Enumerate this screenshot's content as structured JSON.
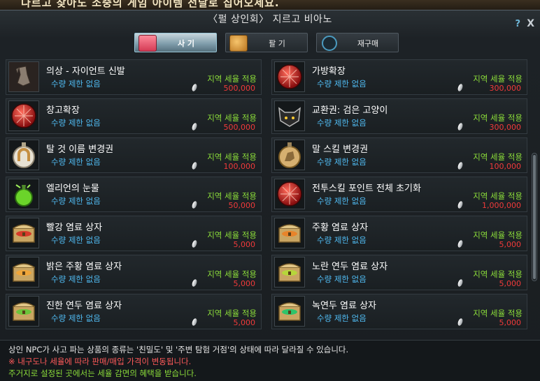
{
  "top_strip_text": "다르고 찾아도 소중의 게임 아이템 전달로 집어오세요.",
  "title": "〈펄 상인회〉 지르고 비아노",
  "help_label": "?",
  "close_label": "X",
  "tabs": [
    {
      "label": "사 기",
      "icon": "shopping-bag-icon",
      "active": true
    },
    {
      "label": "팔 기",
      "icon": "coin-stack-icon",
      "active": false
    },
    {
      "label": "재구매",
      "icon": "repurchase-ring-icon",
      "active": false
    }
  ],
  "tax_label": "지역 세율 적용",
  "items": [
    {
      "name": "의상 - 자이언트 신발",
      "limit": "수량 제한 없음",
      "price": "500,000",
      "icon": "giant-shoes-icon"
    },
    {
      "name": "가방확장",
      "limit": "수량 제한 없음",
      "price": "300,000",
      "icon": "red-orb-icon"
    },
    {
      "name": "창고확장",
      "limit": "수량 제한 없음",
      "price": "500,000",
      "icon": "red-orb-icon"
    },
    {
      "name": "교환권: 검은 고양이",
      "limit": "수량 제한 없음",
      "price": "300,000",
      "icon": "black-cat-icon"
    },
    {
      "name": "탈 것 이름 변경권",
      "limit": "수량 제한 없음",
      "price": "100,000",
      "icon": "horseshoe-medal-icon"
    },
    {
      "name": "말 스킬 변경권",
      "limit": "수량 제한 없음",
      "price": "100,000",
      "icon": "horse-skill-medal-icon"
    },
    {
      "name": "엘리언의 눈물",
      "limit": "수량 제한 없음",
      "price": "50,000",
      "icon": "green-potion-icon"
    },
    {
      "name": "전투스킬 포인트 전체 초기화",
      "limit": "수량 제한 없음",
      "price": "1,000,000",
      "icon": "red-orb-icon"
    },
    {
      "name": "빨강 염료 상자",
      "limit": "수량 제한 없음",
      "price": "5,000",
      "icon": "dye-chest-icon",
      "dye": "#d63a2a"
    },
    {
      "name": "주황 염료 상자",
      "limit": "수량 제한 없음",
      "price": "5,000",
      "icon": "dye-chest-icon",
      "dye": "#e8842a"
    },
    {
      "name": "밝은 주황 염료 상자",
      "limit": "수량 제한 없음",
      "price": "5,000",
      "icon": "dye-chest-icon",
      "dye": "#f0a63a"
    },
    {
      "name": "노란 연두 염료 상자",
      "limit": "수량 제한 없음",
      "price": "5,000",
      "icon": "dye-chest-icon",
      "dye": "#b6d63a"
    },
    {
      "name": "진한 연두 염료 상자",
      "limit": "수량 제한 없음",
      "price": "5,000",
      "icon": "dye-chest-icon",
      "dye": "#6cc43a"
    },
    {
      "name": "녹연두 염료 상자",
      "limit": "수량 제한 없음",
      "price": "5,000",
      "icon": "dye-chest-icon",
      "dye": "#2ec46a"
    }
  ],
  "footer": {
    "line1": "상인 NPC가 사고 파는 상품의 종류는 '친밀도' 및 '주변 탐험 거점'의 상태에 따라 달라질 수 있습니다.",
    "line2": "※ 내구도나 세율에 따라 판매/매입 가격이 변동됩니다.",
    "line3": "주거지로 설정된 곳에서는 세율 감면의 혜택을 받습니다."
  },
  "colors": {
    "limit_text": "#4fb9f0",
    "tax_text": "#8bdc3a",
    "price_text": "#f03a3a",
    "warning_text": "#ff5a5a"
  }
}
